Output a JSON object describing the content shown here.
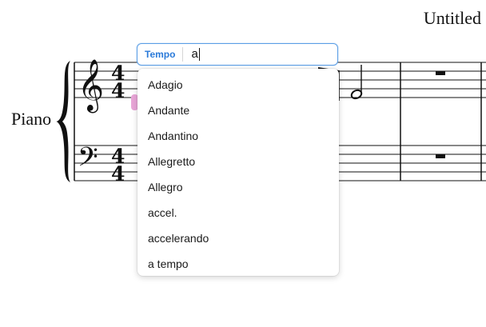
{
  "score": {
    "title": "Untitled",
    "instrument": "Piano",
    "time_signature": {
      "numerator": "4",
      "denominator": "4"
    }
  },
  "tempo_popup": {
    "chip_label": "Tempo",
    "input_value": "a",
    "suggestions": [
      "Adagio",
      "Andante",
      "Andantino",
      "Allegretto",
      "Allegro",
      "accel.",
      "accelerando",
      "a tempo"
    ]
  },
  "colors": {
    "accent": "#2a7ad9",
    "selection": "#e9a6d8",
    "staff": "#111111"
  }
}
